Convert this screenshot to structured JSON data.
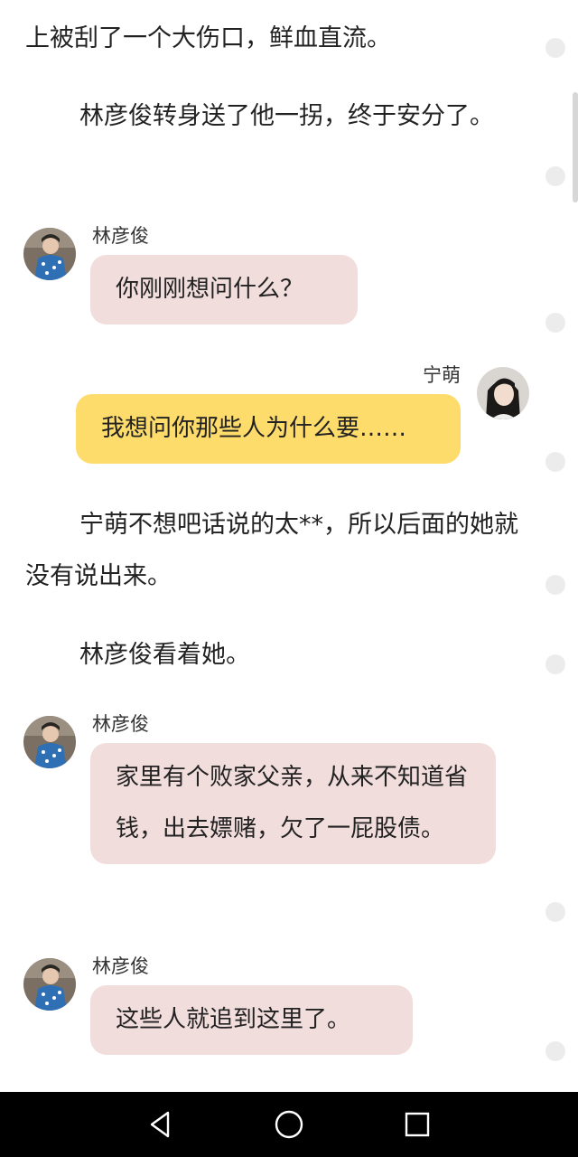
{
  "story": {
    "p1": "上被刮了一个大伤口，鲜血直流。",
    "p2": "林彦俊转身送了他一拐，终于安分了。",
    "p3": "宁萌不想吧话说的太**，所以后面的她就没有说出来。",
    "p4": "林彦俊看着她。"
  },
  "messages": {
    "m1": {
      "speaker": "林彦俊",
      "text": "你刚刚想问什么？"
    },
    "m2": {
      "speaker": "宁萌",
      "text": "我想问你那些人为什么要……"
    },
    "m3": {
      "speaker": "林彦俊",
      "text": "家里有个败家父亲，从来不知道省钱，出去嫖赌，欠了一屁股债。"
    },
    "m4": {
      "speaker": "林彦俊",
      "text": "这些人就追到这里了。"
    }
  },
  "colors": {
    "left_bubble": "#f2dddd",
    "right_bubble": "#fddc6b",
    "navbar": "#000000"
  },
  "icons": {
    "back": "triangle-back-icon",
    "home": "circle-home-icon",
    "recents": "square-recents-icon"
  }
}
